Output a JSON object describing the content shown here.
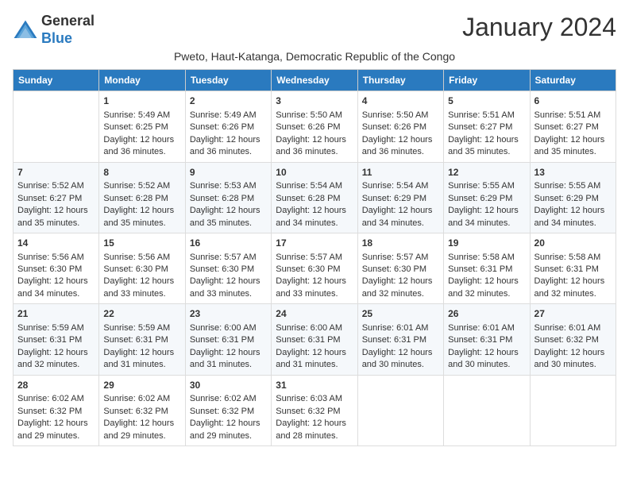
{
  "header": {
    "logo_general": "General",
    "logo_blue": "Blue",
    "month_title": "January 2024",
    "location": "Pweto, Haut-Katanga, Democratic Republic of the Congo"
  },
  "days_of_week": [
    "Sunday",
    "Monday",
    "Tuesday",
    "Wednesday",
    "Thursday",
    "Friday",
    "Saturday"
  ],
  "weeks": [
    [
      {
        "day": "",
        "sunrise": "",
        "sunset": "",
        "daylight": ""
      },
      {
        "day": "1",
        "sunrise": "Sunrise: 5:49 AM",
        "sunset": "Sunset: 6:25 PM",
        "daylight": "Daylight: 12 hours and 36 minutes."
      },
      {
        "day": "2",
        "sunrise": "Sunrise: 5:49 AM",
        "sunset": "Sunset: 6:26 PM",
        "daylight": "Daylight: 12 hours and 36 minutes."
      },
      {
        "day": "3",
        "sunrise": "Sunrise: 5:50 AM",
        "sunset": "Sunset: 6:26 PM",
        "daylight": "Daylight: 12 hours and 36 minutes."
      },
      {
        "day": "4",
        "sunrise": "Sunrise: 5:50 AM",
        "sunset": "Sunset: 6:26 PM",
        "daylight": "Daylight: 12 hours and 36 minutes."
      },
      {
        "day": "5",
        "sunrise": "Sunrise: 5:51 AM",
        "sunset": "Sunset: 6:27 PM",
        "daylight": "Daylight: 12 hours and 35 minutes."
      },
      {
        "day": "6",
        "sunrise": "Sunrise: 5:51 AM",
        "sunset": "Sunset: 6:27 PM",
        "daylight": "Daylight: 12 hours and 35 minutes."
      }
    ],
    [
      {
        "day": "7",
        "sunrise": "Sunrise: 5:52 AM",
        "sunset": "Sunset: 6:27 PM",
        "daylight": "Daylight: 12 hours and 35 minutes."
      },
      {
        "day": "8",
        "sunrise": "Sunrise: 5:52 AM",
        "sunset": "Sunset: 6:28 PM",
        "daylight": "Daylight: 12 hours and 35 minutes."
      },
      {
        "day": "9",
        "sunrise": "Sunrise: 5:53 AM",
        "sunset": "Sunset: 6:28 PM",
        "daylight": "Daylight: 12 hours and 35 minutes."
      },
      {
        "day": "10",
        "sunrise": "Sunrise: 5:54 AM",
        "sunset": "Sunset: 6:28 PM",
        "daylight": "Daylight: 12 hours and 34 minutes."
      },
      {
        "day": "11",
        "sunrise": "Sunrise: 5:54 AM",
        "sunset": "Sunset: 6:29 PM",
        "daylight": "Daylight: 12 hours and 34 minutes."
      },
      {
        "day": "12",
        "sunrise": "Sunrise: 5:55 AM",
        "sunset": "Sunset: 6:29 PM",
        "daylight": "Daylight: 12 hours and 34 minutes."
      },
      {
        "day": "13",
        "sunrise": "Sunrise: 5:55 AM",
        "sunset": "Sunset: 6:29 PM",
        "daylight": "Daylight: 12 hours and 34 minutes."
      }
    ],
    [
      {
        "day": "14",
        "sunrise": "Sunrise: 5:56 AM",
        "sunset": "Sunset: 6:30 PM",
        "daylight": "Daylight: 12 hours and 34 minutes."
      },
      {
        "day": "15",
        "sunrise": "Sunrise: 5:56 AM",
        "sunset": "Sunset: 6:30 PM",
        "daylight": "Daylight: 12 hours and 33 minutes."
      },
      {
        "day": "16",
        "sunrise": "Sunrise: 5:57 AM",
        "sunset": "Sunset: 6:30 PM",
        "daylight": "Daylight: 12 hours and 33 minutes."
      },
      {
        "day": "17",
        "sunrise": "Sunrise: 5:57 AM",
        "sunset": "Sunset: 6:30 PM",
        "daylight": "Daylight: 12 hours and 33 minutes."
      },
      {
        "day": "18",
        "sunrise": "Sunrise: 5:57 AM",
        "sunset": "Sunset: 6:30 PM",
        "daylight": "Daylight: 12 hours and 32 minutes."
      },
      {
        "day": "19",
        "sunrise": "Sunrise: 5:58 AM",
        "sunset": "Sunset: 6:31 PM",
        "daylight": "Daylight: 12 hours and 32 minutes."
      },
      {
        "day": "20",
        "sunrise": "Sunrise: 5:58 AM",
        "sunset": "Sunset: 6:31 PM",
        "daylight": "Daylight: 12 hours and 32 minutes."
      }
    ],
    [
      {
        "day": "21",
        "sunrise": "Sunrise: 5:59 AM",
        "sunset": "Sunset: 6:31 PM",
        "daylight": "Daylight: 12 hours and 32 minutes."
      },
      {
        "day": "22",
        "sunrise": "Sunrise: 5:59 AM",
        "sunset": "Sunset: 6:31 PM",
        "daylight": "Daylight: 12 hours and 31 minutes."
      },
      {
        "day": "23",
        "sunrise": "Sunrise: 6:00 AM",
        "sunset": "Sunset: 6:31 PM",
        "daylight": "Daylight: 12 hours and 31 minutes."
      },
      {
        "day": "24",
        "sunrise": "Sunrise: 6:00 AM",
        "sunset": "Sunset: 6:31 PM",
        "daylight": "Daylight: 12 hours and 31 minutes."
      },
      {
        "day": "25",
        "sunrise": "Sunrise: 6:01 AM",
        "sunset": "Sunset: 6:31 PM",
        "daylight": "Daylight: 12 hours and 30 minutes."
      },
      {
        "day": "26",
        "sunrise": "Sunrise: 6:01 AM",
        "sunset": "Sunset: 6:31 PM",
        "daylight": "Daylight: 12 hours and 30 minutes."
      },
      {
        "day": "27",
        "sunrise": "Sunrise: 6:01 AM",
        "sunset": "Sunset: 6:32 PM",
        "daylight": "Daylight: 12 hours and 30 minutes."
      }
    ],
    [
      {
        "day": "28",
        "sunrise": "Sunrise: 6:02 AM",
        "sunset": "Sunset: 6:32 PM",
        "daylight": "Daylight: 12 hours and 29 minutes."
      },
      {
        "day": "29",
        "sunrise": "Sunrise: 6:02 AM",
        "sunset": "Sunset: 6:32 PM",
        "daylight": "Daylight: 12 hours and 29 minutes."
      },
      {
        "day": "30",
        "sunrise": "Sunrise: 6:02 AM",
        "sunset": "Sunset: 6:32 PM",
        "daylight": "Daylight: 12 hours and 29 minutes."
      },
      {
        "day": "31",
        "sunrise": "Sunrise: 6:03 AM",
        "sunset": "Sunset: 6:32 PM",
        "daylight": "Daylight: 12 hours and 28 minutes."
      },
      {
        "day": "",
        "sunrise": "",
        "sunset": "",
        "daylight": ""
      },
      {
        "day": "",
        "sunrise": "",
        "sunset": "",
        "daylight": ""
      },
      {
        "day": "",
        "sunrise": "",
        "sunset": "",
        "daylight": ""
      }
    ]
  ]
}
